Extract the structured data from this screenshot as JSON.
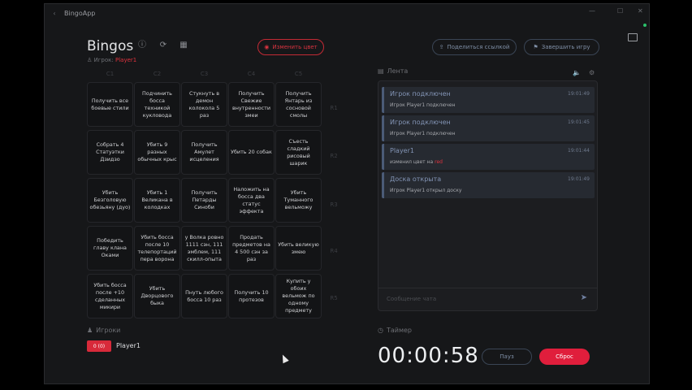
{
  "window": {
    "title": "BingoApp",
    "back": "‹",
    "min": "—",
    "max": "☐",
    "close": "✕"
  },
  "header": {
    "title": "Bingos",
    "player_prefix": "Игрок:",
    "player_name": "Player1",
    "change_color": "Изменить цвет",
    "share_link": "Поделиться ссылкой",
    "end_game": "Завершить игру"
  },
  "board": {
    "columns": [
      "C1",
      "C2",
      "C3",
      "C4",
      "C5"
    ],
    "rows": [
      "R1",
      "R2",
      "R3",
      "R4",
      "R5"
    ],
    "cells": [
      [
        "Получить все боевые стили",
        "Подчинить босса техникой кукловода",
        "Стукнуть в демон колокола 5 раз",
        "Получить Свежие внутренности змеи",
        "Получить Янтарь из сосновой смолы"
      ],
      [
        "Собрать 4 Статуэтки Дзидзо",
        "Убить 9 разных обычных крыс",
        "Получить Амулет исцеления",
        "Убить 20 собак",
        "Съесть сладкий рисовый шарик"
      ],
      [
        "Убить Безголовую обезьяну (дуо)",
        "Убить 1 Великана в колодках",
        "Получить Петарды Синоби",
        "Наложить на босса два статус эффекта",
        "Убить Туманного вельможу"
      ],
      [
        "Победить главу клана Оками",
        "Убить босса после 10 телепортаций пера ворона",
        "у Волка ровно 1111 сэн, 111 эмблем, 111 скилл-опыта",
        "Продать предметов на 4 500 сэн за раз",
        "Убить великую змею"
      ],
      [
        "Убить босса после +10 сделанных микири",
        "Убить Дворцового быка",
        "Пнуть любого босса 10 раз",
        "Получить 10 протезов",
        "Купить у обоих вельмож по одному предмету"
      ]
    ]
  },
  "feed": {
    "title": "Лента",
    "items": [
      {
        "title": "Игрок подключен",
        "time": "19:01:49",
        "body": "Игрок Player1 подключен",
        "highlight": ""
      },
      {
        "title": "Игрок подключен",
        "time": "19:01:45",
        "body": "Игрок Player1 подключен",
        "highlight": ""
      },
      {
        "title": "Player1",
        "time": "19:01:44",
        "body": "изменил цвет на",
        "highlight": "red"
      },
      {
        "title": "Доска открыта",
        "time": "19:01:49",
        "body": "Игрок Player1 открыл доску",
        "highlight": ""
      }
    ],
    "chat_placeholder": "Сообщение чата",
    "send": "➤"
  },
  "players": {
    "title": "Игроки",
    "list": [
      {
        "badge": "0 (0)",
        "name": "Player1"
      }
    ]
  },
  "timer": {
    "title": "Таймер",
    "value": "00:00:58",
    "pause": "Пауз",
    "reset": "Сброс"
  },
  "colors": {
    "accent": "#e01e3c",
    "feed_title": "#8394b5",
    "background": "#161719"
  }
}
